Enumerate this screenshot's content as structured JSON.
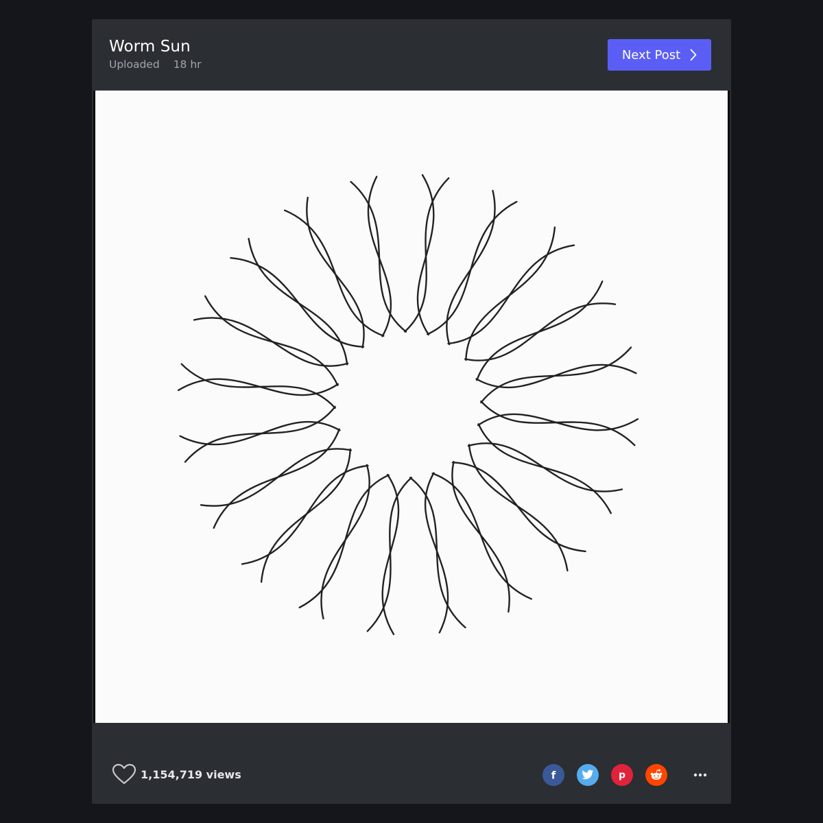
{
  "post": {
    "title": "Worm Sun",
    "uploaded_label": "Uploaded",
    "age": "18 hr"
  },
  "nav": {
    "next_label": "Next Post",
    "next_icon": "chevron-right-icon"
  },
  "image": {
    "subject": "worm sun drawing",
    "background": "#fbfbfb",
    "stroke": "#222222"
  },
  "stats": {
    "views": "1,154,719 views",
    "like_icon": "heart-outline-icon"
  },
  "share": [
    {
      "name": "facebook",
      "icon": "facebook-icon",
      "color": "#3b5998"
    },
    {
      "name": "twitter",
      "icon": "twitter-icon",
      "color": "#55acee"
    },
    {
      "name": "pinterest",
      "icon": "pinterest-icon",
      "color": "#e0233b"
    },
    {
      "name": "reddit",
      "icon": "reddit-icon",
      "color": "#ff4500"
    }
  ],
  "more_icon": "more-horizontal-icon",
  "colors": {
    "page_bg": "#15161b",
    "card_bg": "#2b2e33",
    "accent": "#5b5ef5"
  }
}
